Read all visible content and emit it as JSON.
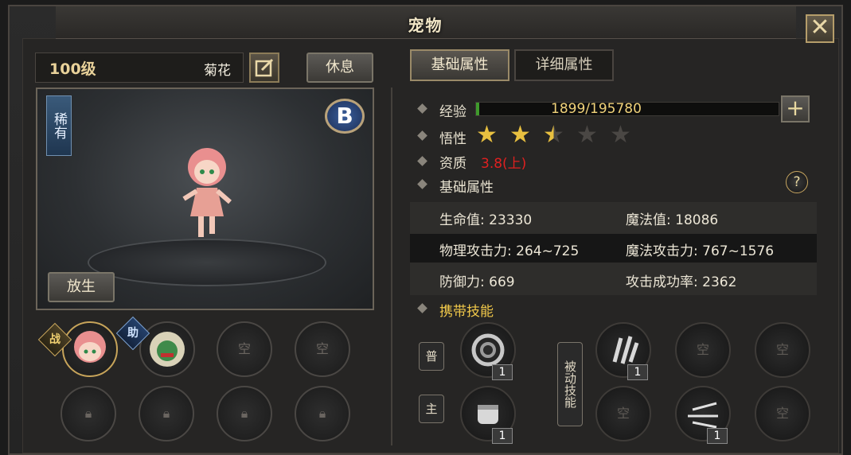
{
  "window": {
    "title": "宠物",
    "close_icon": "close-icon"
  },
  "pet": {
    "level": "100级",
    "name": "菊花",
    "rarity": "稀有",
    "grade": "B"
  },
  "buttons": {
    "rest": "休息",
    "release": "放生"
  },
  "slots": {
    "battle_tag": "战",
    "assist_tag": "助",
    "empty": [
      "空",
      "空"
    ]
  },
  "tabs": [
    {
      "label": "基础属性",
      "active": true
    },
    {
      "label": "详细属性",
      "active": false
    }
  ],
  "properties": {
    "exp_label": "经验",
    "exp_value": "1899/195780",
    "exp_fraction": 0.0097,
    "insight_label": "悟性",
    "insight_stars": 2.5,
    "insight_max": 5,
    "aptitude_label": "资质",
    "aptitude_value": "3.8(上)",
    "base_label": "基础属性",
    "help_icon": "?"
  },
  "stats": {
    "hp": "生命值: 23330",
    "mp": "魔法值: 18086",
    "phys_atk": "物理攻击力: 264~725",
    "magic_atk": "魔法攻击力: 767~1576",
    "defense": "防御力: 669",
    "hit_rate": "攻击成功率: 2362"
  },
  "skills": {
    "title": "携带技能",
    "normal_label": "普",
    "active_label": "主",
    "passive_label": "被动技能",
    "normal_count": "1",
    "active_count": "1",
    "passive_1_count": "1",
    "passive_3_count": "1",
    "empty_label": "空"
  },
  "colors": {
    "accent": "#f0c84a",
    "aptitude": "#e02020",
    "exp": "#3f9a2c"
  }
}
